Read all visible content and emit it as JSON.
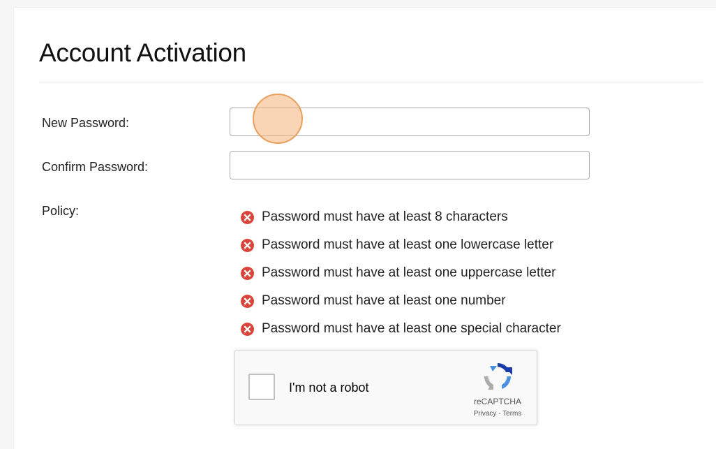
{
  "page": {
    "title": "Account Activation"
  },
  "form": {
    "new_password_label": "New Password:",
    "new_password_value": "",
    "confirm_password_label": "Confirm Password:",
    "confirm_password_value": "",
    "policy_label": "Policy:"
  },
  "policy": {
    "status_icon": "x-circle-icon",
    "status_color": "#d9443b",
    "items": [
      "Password must have at least 8 characters",
      "Password must have at least one lowercase letter",
      "Password must have at least one uppercase letter",
      "Password must have at least one number",
      "Password must have at least one special character"
    ]
  },
  "recaptcha": {
    "checkbox_label": "I'm not a robot",
    "brand": "reCAPTCHA",
    "privacy_link": "Privacy",
    "separator": " - ",
    "terms_link": "Terms"
  }
}
